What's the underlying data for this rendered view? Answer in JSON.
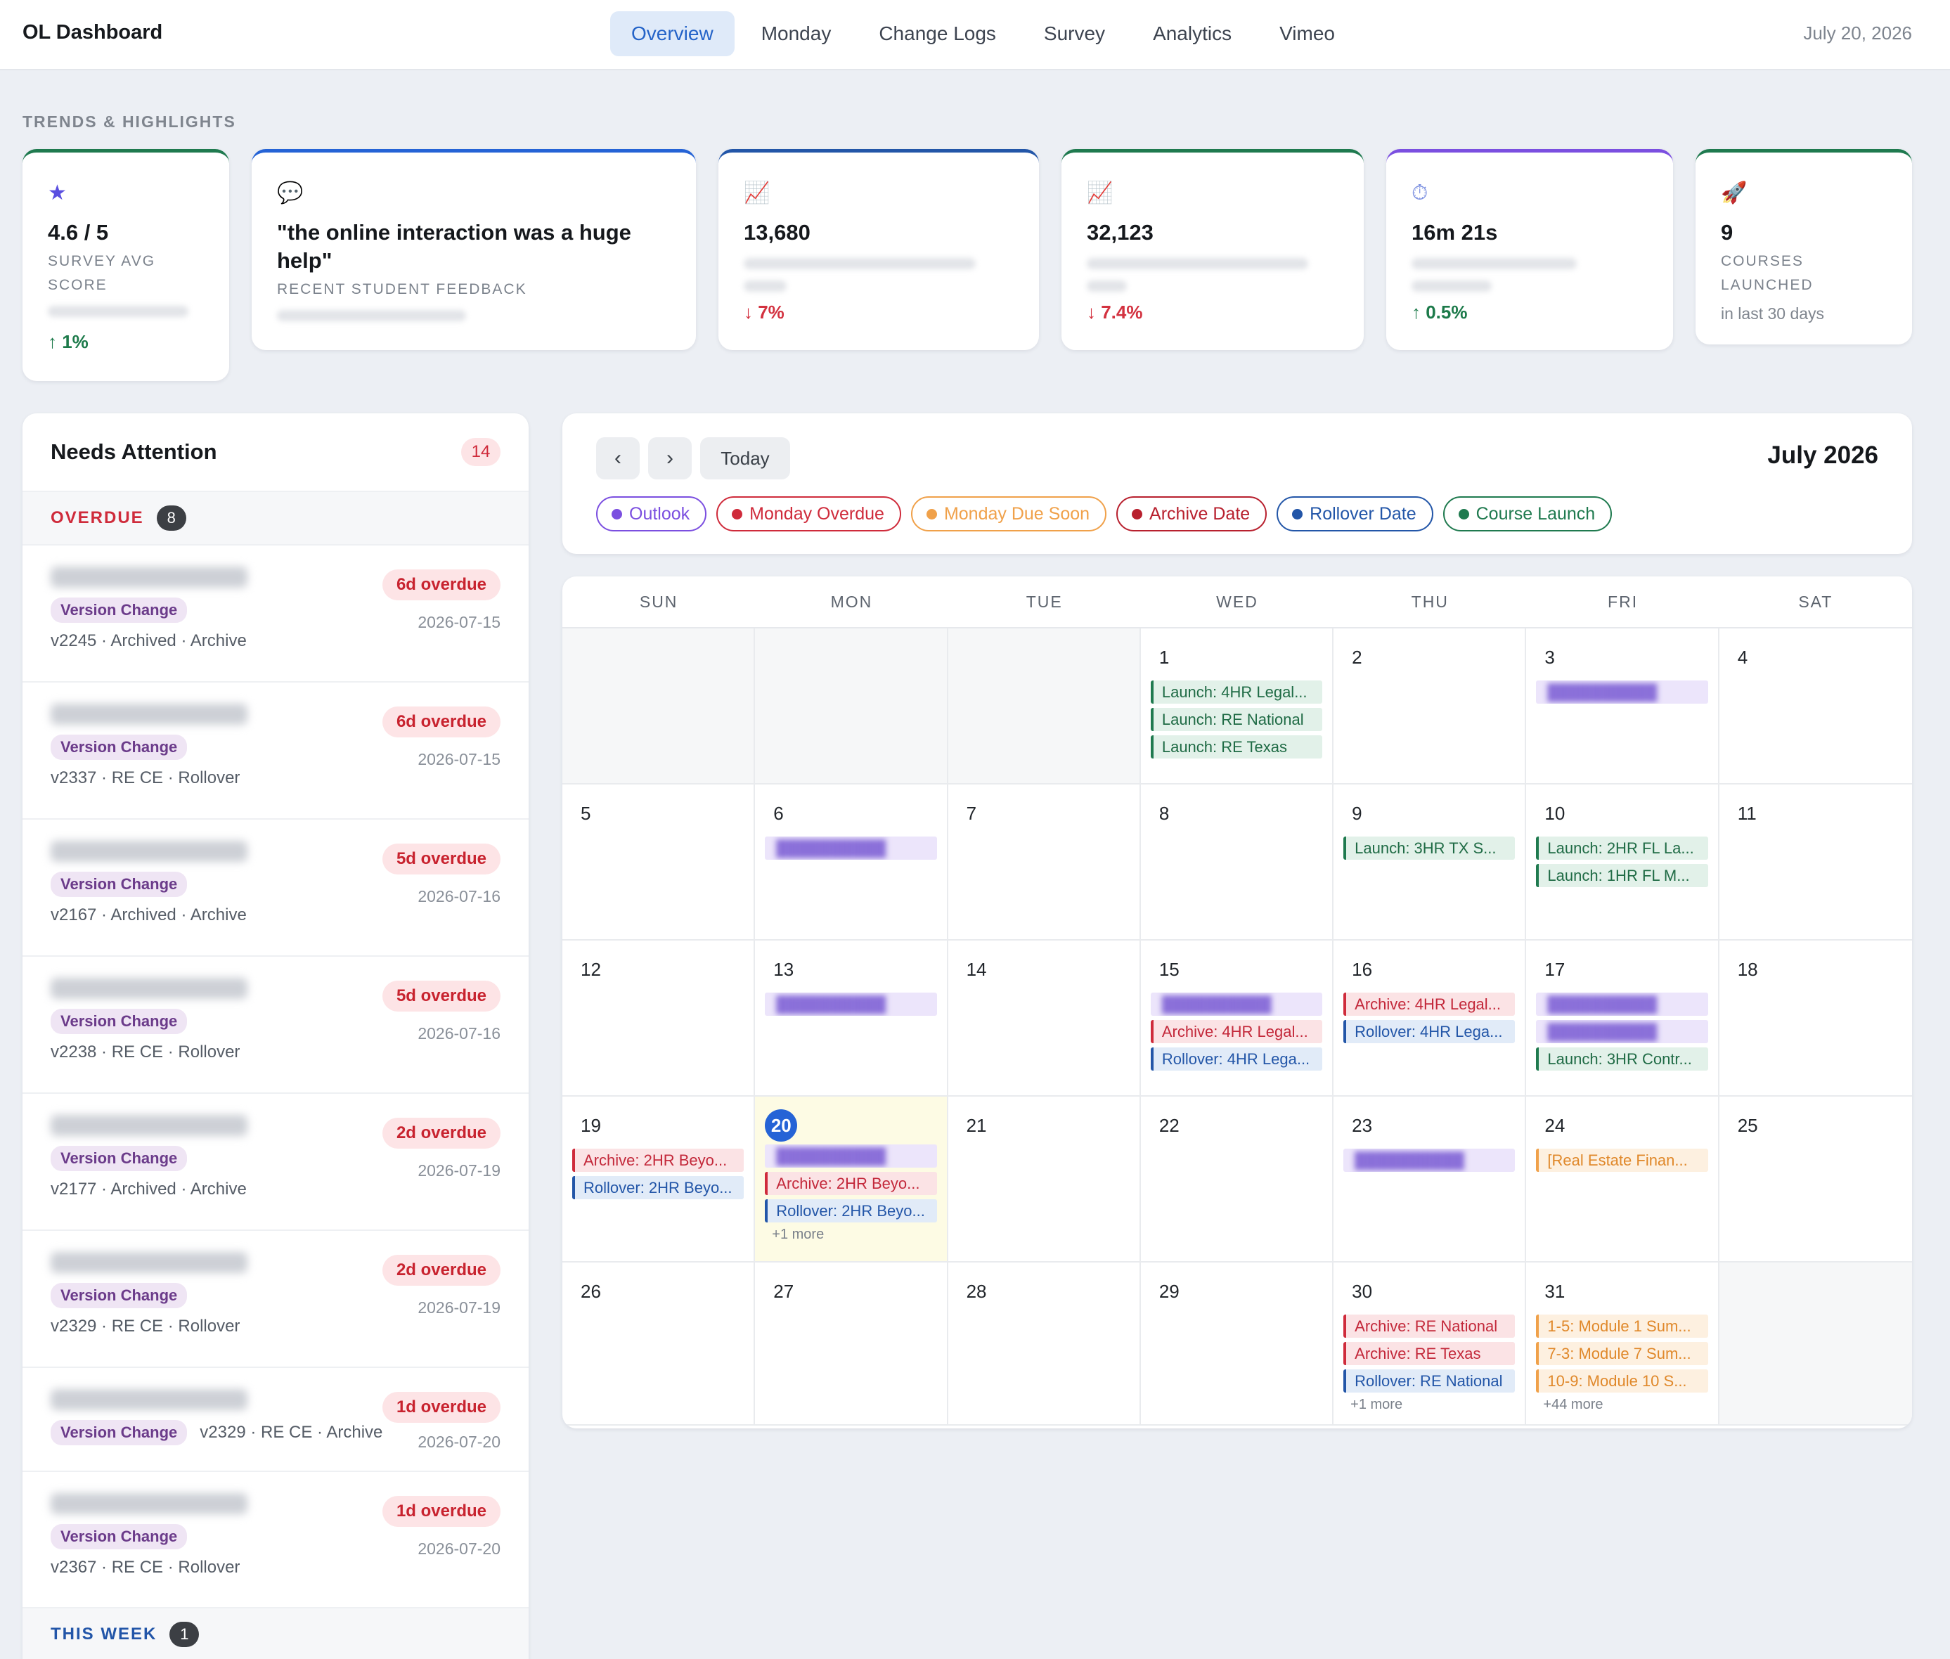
{
  "app": {
    "title": "OL Dashboard",
    "date": "July 20, 2026"
  },
  "nav": {
    "tabs": [
      "Overview",
      "Monday",
      "Change Logs",
      "Survey",
      "Analytics",
      "Vimeo"
    ],
    "active": "Overview"
  },
  "trends": {
    "label": "TRENDS & HIGHLIGHTS",
    "cards": [
      {
        "icon": "star-icon",
        "glyph": "★",
        "value": "4.6 / 5",
        "label": "SURVEY AVG SCORE",
        "delta": "↑ 1%",
        "direction": "up",
        "accent": "#1f7a4f"
      },
      {
        "icon": "speech-bubble-icon",
        "glyph": "💬",
        "value": "\"the online interaction was a huge help\"",
        "label": "RECENT STUDENT FEEDBACK",
        "accent": "#2563d6"
      },
      {
        "icon": "chart-icon",
        "glyph": "📈",
        "value": "13,680",
        "delta": "↓ 7%",
        "direction": "down",
        "accent": "#2356a8"
      },
      {
        "icon": "chart-icon",
        "glyph": "📈",
        "value": "32,123",
        "delta": "↓ 7.4%",
        "direction": "down",
        "accent": "#1f7a4f"
      },
      {
        "icon": "stopwatch-icon",
        "glyph": "⏱",
        "value": "16m 21s",
        "delta": "↑ 0.5%",
        "direction": "up",
        "accent": "#7b4fe0"
      },
      {
        "icon": "rocket-icon",
        "glyph": "🚀",
        "value": "9",
        "label": "COURSES LAUNCHED",
        "note": "in last 30 days",
        "accent": "#1f7a4f"
      }
    ]
  },
  "attention": {
    "title": "Needs Attention",
    "count": "14",
    "groups": [
      {
        "title": "OVERDUE",
        "count": "8"
      },
      {
        "title": "THIS WEEK",
        "count": "1"
      }
    ],
    "items": [
      {
        "tag": "Version Change",
        "meta": "v2245 · Archived · Archive",
        "overdue": "6d overdue",
        "date": "2026-07-15"
      },
      {
        "tag": "Version Change",
        "meta": "v2337 · RE CE · Rollover",
        "overdue": "6d overdue",
        "date": "2026-07-15"
      },
      {
        "tag": "Version Change",
        "meta": "v2167 · Archived · Archive",
        "overdue": "5d overdue",
        "date": "2026-07-16"
      },
      {
        "tag": "Version Change",
        "meta": "v2238 · RE CE · Rollover",
        "overdue": "5d overdue",
        "date": "2026-07-16"
      },
      {
        "tag": "Version Change",
        "meta": "v2177 · Archived · Archive",
        "overdue": "2d overdue",
        "date": "2026-07-19"
      },
      {
        "tag": "Version Change",
        "meta": "v2329 · RE CE · Rollover",
        "overdue": "2d overdue",
        "date": "2026-07-19"
      },
      {
        "tag": "Version Change",
        "meta": "v2329 · RE CE · Archive",
        "overdue": "1d overdue",
        "date": "2026-07-20"
      },
      {
        "tag": "Version Change",
        "meta": "v2367 · RE CE · Rollover",
        "overdue": "1d overdue",
        "date": "2026-07-20"
      }
    ]
  },
  "calendar": {
    "month": "July 2026",
    "today_label": "Today",
    "prev": "‹",
    "next": "›",
    "legend": [
      {
        "label": "Outlook",
        "color": "#7b4fe0"
      },
      {
        "label": "Monday Overdue",
        "color": "#cf2b3b"
      },
      {
        "label": "Monday Due Soon",
        "color": "#f0a14a"
      },
      {
        "label": "Archive Date",
        "color": "#b8202e"
      },
      {
        "label": "Rollover Date",
        "color": "#2356a8"
      },
      {
        "label": "Course Launch",
        "color": "#1f7a4f"
      }
    ],
    "weekdays": [
      "SUN",
      "MON",
      "TUE",
      "WED",
      "THU",
      "FRI",
      "SAT"
    ],
    "today": 20,
    "days": [
      {
        "empty": true
      },
      {
        "empty": true
      },
      {
        "empty": true
      },
      {
        "n": "1",
        "events": [
          {
            "k": "launch",
            "t": "Launch: 4HR Legal..."
          },
          {
            "k": "launch",
            "t": "Launch: RE National"
          },
          {
            "k": "launch",
            "t": "Launch: RE Texas"
          }
        ]
      },
      {
        "n": "2",
        "events": []
      },
      {
        "n": "3",
        "events": [
          {
            "k": "outlook",
            "t": ""
          }
        ]
      },
      {
        "n": "4",
        "events": []
      },
      {
        "n": "5",
        "events": []
      },
      {
        "n": "6",
        "events": [
          {
            "k": "outlook",
            "t": ""
          }
        ]
      },
      {
        "n": "7",
        "events": []
      },
      {
        "n": "8",
        "events": []
      },
      {
        "n": "9",
        "events": [
          {
            "k": "launch",
            "t": "Launch: 3HR TX S..."
          }
        ]
      },
      {
        "n": "10",
        "events": [
          {
            "k": "launch",
            "t": "Launch: 2HR FL La..."
          },
          {
            "k": "launch",
            "t": "Launch: 1HR FL M..."
          }
        ]
      },
      {
        "n": "11",
        "events": []
      },
      {
        "n": "12",
        "events": []
      },
      {
        "n": "13",
        "events": [
          {
            "k": "outlook",
            "t": ""
          }
        ]
      },
      {
        "n": "14",
        "events": []
      },
      {
        "n": "15",
        "events": [
          {
            "k": "outlook",
            "t": ""
          },
          {
            "k": "archive",
            "t": "Archive: 4HR Legal..."
          },
          {
            "k": "rollover",
            "t": "Rollover: 4HR Lega..."
          }
        ]
      },
      {
        "n": "16",
        "events": [
          {
            "k": "archive",
            "t": "Archive: 4HR Legal..."
          },
          {
            "k": "rollover",
            "t": "Rollover: 4HR Lega..."
          }
        ]
      },
      {
        "n": "17",
        "events": [
          {
            "k": "outlook",
            "t": ""
          },
          {
            "k": "outlook",
            "t": ""
          },
          {
            "k": "launch",
            "t": "Launch: 3HR Contr..."
          }
        ]
      },
      {
        "n": "18",
        "events": []
      },
      {
        "n": "19",
        "events": [
          {
            "k": "archive",
            "t": "Archive: 2HR Beyo..."
          },
          {
            "k": "rollover",
            "t": "Rollover: 2HR Beyo..."
          }
        ]
      },
      {
        "n": "20",
        "events": [
          {
            "k": "outlook",
            "t": ""
          },
          {
            "k": "archive",
            "t": "Archive: 2HR Beyo..."
          },
          {
            "k": "rollover",
            "t": "Rollover: 2HR Beyo..."
          }
        ],
        "more": "+1 more"
      },
      {
        "n": "21",
        "events": []
      },
      {
        "n": "22",
        "events": []
      },
      {
        "n": "23",
        "events": [
          {
            "k": "outlook",
            "t": ""
          }
        ]
      },
      {
        "n": "24",
        "events": [
          {
            "k": "due",
            "t": "[Real Estate Finan..."
          }
        ]
      },
      {
        "n": "25",
        "events": []
      },
      {
        "n": "26",
        "events": []
      },
      {
        "n": "27",
        "events": []
      },
      {
        "n": "28",
        "events": []
      },
      {
        "n": "29",
        "events": []
      },
      {
        "n": "30",
        "events": [
          {
            "k": "archive",
            "t": "Archive: RE National"
          },
          {
            "k": "archive",
            "t": "Archive: RE Texas"
          },
          {
            "k": "rollover",
            "t": "Rollover: RE National"
          }
        ],
        "more": "+1 more"
      },
      {
        "n": "31",
        "events": [
          {
            "k": "due",
            "t": "1-5: Module 1 Sum..."
          },
          {
            "k": "due",
            "t": "7-3: Module 7 Sum..."
          },
          {
            "k": "due",
            "t": "10-9: Module 10 S..."
          }
        ],
        "more": "+44 more"
      },
      {
        "empty": true
      }
    ]
  }
}
